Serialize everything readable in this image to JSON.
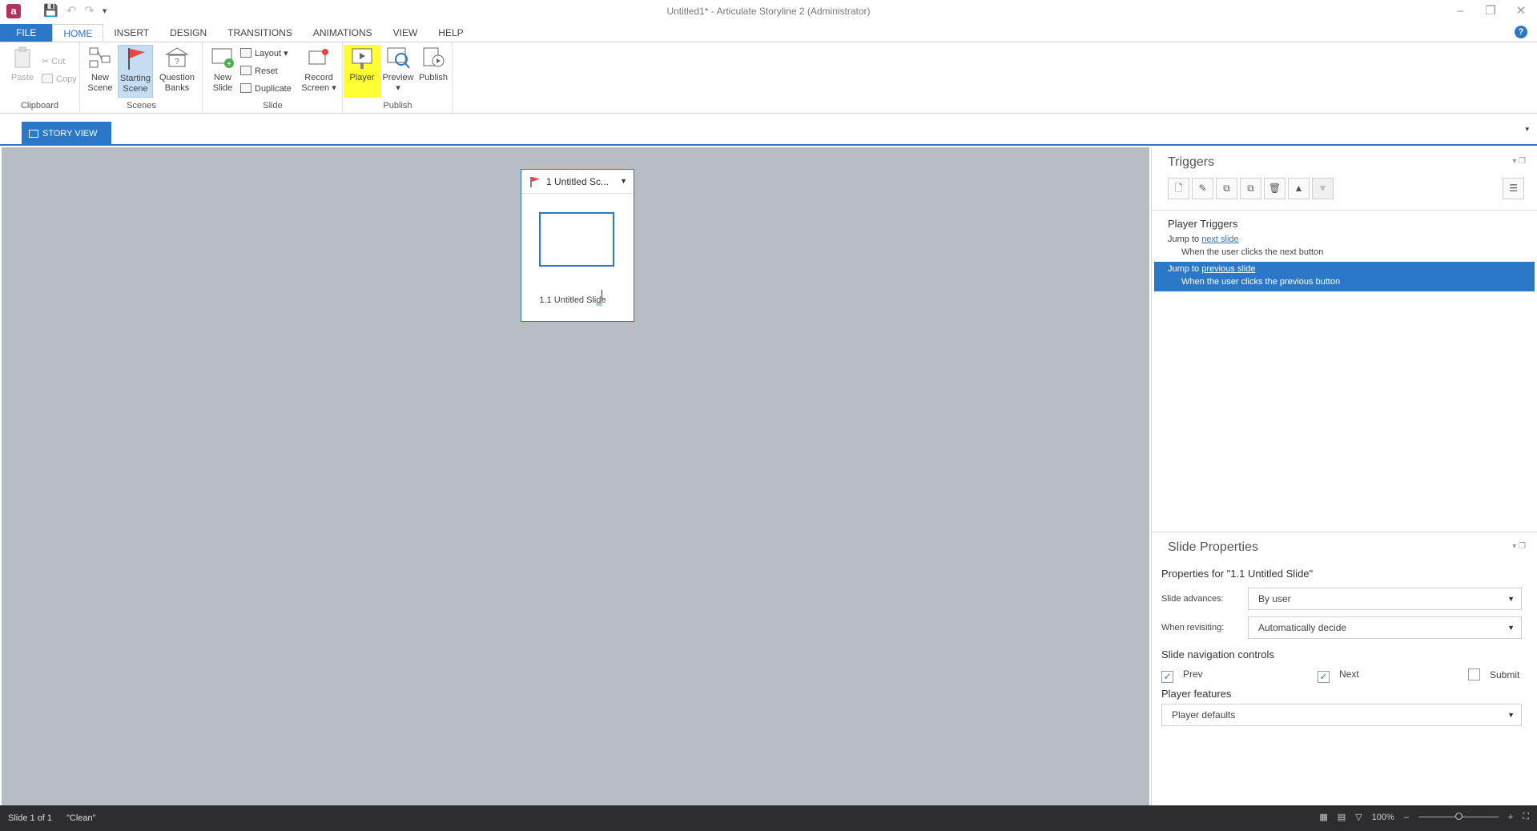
{
  "titlebar": {
    "window_title": "Untitled1* - Articulate Storyline 2 (Administrator)",
    "app_icon": "a",
    "qat_save": "💾",
    "qat_undo": "↶",
    "qat_redo": "↷",
    "qat_more": "▾",
    "minimize": "–",
    "restore": "❐",
    "close": "✕"
  },
  "ribbon_tabs": [
    "FILE",
    "HOME",
    "INSERT",
    "DESIGN",
    "TRANSITIONS",
    "ANIMATIONS",
    "VIEW",
    "HELP"
  ],
  "help_icon": "?",
  "ribbon": {
    "clipboard": {
      "label": "Clipboard",
      "paste": "Paste",
      "cut": "Cut",
      "copy": "Copy"
    },
    "scenes": {
      "label": "Scenes",
      "new_scene_1": "New",
      "new_scene_2": "Scene",
      "starting_scene_1": "Starting",
      "starting_scene_2": "Scene",
      "question_banks_1": "Question",
      "question_banks_2": "Banks"
    },
    "slide": {
      "label": "Slide",
      "new_slide_1": "New",
      "new_slide_2": "Slide",
      "layout": "Layout",
      "reset": "Reset",
      "duplicate": "Duplicate",
      "record_screen_1": "Record",
      "record_screen_2": "Screen"
    },
    "publish": {
      "label": "Publish",
      "player": "Player",
      "preview": "Preview",
      "publish": "Publish"
    }
  },
  "viewbar": {
    "story_view": "STORY VIEW",
    "arrow": "▾"
  },
  "canvas": {
    "scene_title": "1 Untitled Sc...",
    "scene_drop": "▼",
    "slide_label": "1.1 Untitled Slide",
    "link_icon": "∞"
  },
  "triggers": {
    "title": "Triggers",
    "panel_ctrls": "▾ ❐",
    "toolbar": [
      "🗋",
      "✎",
      "⧉",
      "⧉",
      "🗑",
      "▲",
      "▼"
    ],
    "toolbar_extra": "☰",
    "group_title": "Player Triggers",
    "rows": [
      {
        "prefix": "Jump to ",
        "link": "next slide",
        "condition": "When the user clicks the next button"
      },
      {
        "prefix": "Jump to ",
        "link": "previous slide",
        "condition": "When the user clicks the previous button"
      }
    ]
  },
  "slide_properties": {
    "title": "Slide Properties",
    "panel_ctrls": "▾ ❐",
    "properties_for": "Properties for \"1.1 Untitled Slide\"",
    "slide_advances_label": "Slide advances:",
    "slide_advances_value": "By user",
    "when_revisiting_label": "When revisiting:",
    "when_revisiting_value": "Automatically decide",
    "nav_controls_title": "Slide navigation controls",
    "prev": {
      "label": "Prev",
      "checked": true
    },
    "next": {
      "label": "Next",
      "checked": true
    },
    "submit": {
      "label": "Submit",
      "checked": false
    },
    "player_features_title": "Player features",
    "player_features_value": "Player defaults",
    "dropdown_arrow": "▼",
    "check_mark": "✓"
  },
  "statusbar": {
    "slide_count": "Slide 1 of 1",
    "theme": "\"Clean\"",
    "zoom": "100%",
    "zoom_minus": "–",
    "zoom_plus": "+",
    "fit_icon": "⛶",
    "view_icons": [
      "▦",
      "▤",
      "▽"
    ]
  },
  "colors": {
    "accent": "#2b78c8",
    "highlight": "#ffff33",
    "canvas": "#b8bcc3",
    "statusbar": "#2d2d30"
  }
}
